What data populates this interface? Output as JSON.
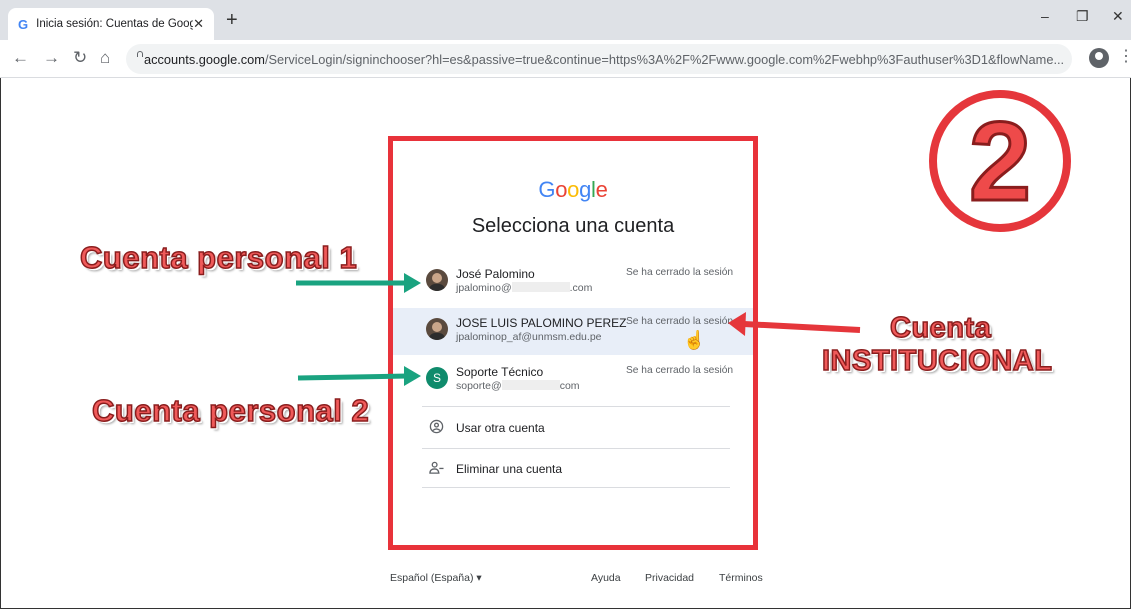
{
  "browser": {
    "tab_title": "Inicia sesión: Cuentas de Google",
    "tab_close": "✕",
    "new_tab": "+",
    "url_host": "accounts.google.com",
    "url_rest": "/ServiceLogin/signinchooser?hl=es&passive=true&continue=https%3A%2F%2Fwww.google.com%2Fwebhp%3Fauthuser%3D1&flowName...",
    "window_minimize": "–",
    "window_restore": "❐",
    "window_close": "✕"
  },
  "card": {
    "logo": [
      "G",
      "o",
      "o",
      "g",
      "l",
      "e"
    ],
    "logo_colors": [
      "#4285f4",
      "#ea4335",
      "#fbbc05",
      "#4285f4",
      "#34a853",
      "#ea4335"
    ],
    "heading": "Selecciona una cuenta",
    "accounts": [
      {
        "name": "José Palomino",
        "email_start": "jpalomino@",
        "email_end": ".com",
        "status": "Se ha cerrado la sesión"
      },
      {
        "name": "JOSE LUIS PALOMINO PEREZ",
        "email": "jpalominop_af@unmsm.edu.pe",
        "status": "Se ha cerrado la sesión"
      },
      {
        "name": "Soporte Técnico",
        "avatar_letter": "S",
        "email_start": "soporte@",
        "email_end": "com",
        "status": "Se ha cerrado la sesión"
      }
    ],
    "options": [
      {
        "label": "Usar otra cuenta",
        "icon": "account-circle-icon"
      },
      {
        "label": "Eliminar una cuenta",
        "icon": "person-remove-icon"
      }
    ]
  },
  "footer": {
    "language": "Español (España)",
    "links": [
      "Ayuda",
      "Privacidad",
      "Términos"
    ]
  },
  "annotations": {
    "personal_1": "Cuenta personal 1",
    "personal_2": "Cuenta personal 2",
    "institutional_1": "Cuenta",
    "institutional_2": "INSTITUCIONAL",
    "step_number": "2",
    "accent_color": "#e8323a",
    "arrow_green": "#1aa380"
  }
}
